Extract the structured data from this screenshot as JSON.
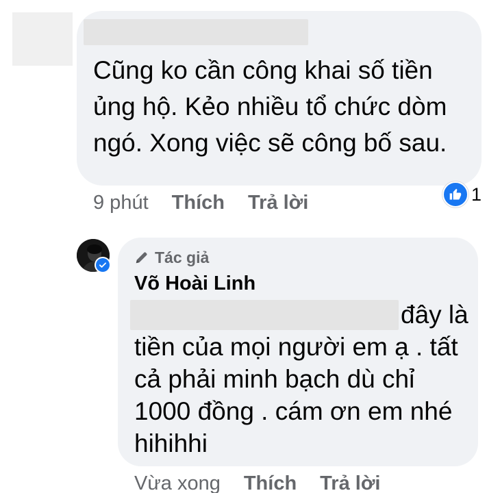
{
  "comment": {
    "text": "Cũng ko cần công khai số tiền ủng hộ. Kẻo nhiều tổ chức dòm ngó. Xong việc sẽ công bố sau.",
    "timestamp": "9 phút",
    "like_label": "Thích",
    "reply_label": "Trả lời",
    "reaction": {
      "icon": "thumbs-up-icon",
      "count": "1",
      "color": "#1877f2"
    },
    "author_redacted": true
  },
  "reply": {
    "author_badge": "Tác giả",
    "author_name": "Võ Hoài Linh",
    "text": "đây là tiền của mọi người em ạ . tất cả phải minh bạch dù chỉ 1000 đồng . cám ơn em nhé hihihhi",
    "timestamp": "Vừa xong",
    "like_label": "Thích",
    "reply_label": "Trả lời",
    "verified": true,
    "verified_color": "#1877f2"
  },
  "colors": {
    "bubble": "#f0f2f5",
    "meta_text": "#65676b",
    "body_text": "#050505",
    "accent": "#1877f2"
  }
}
